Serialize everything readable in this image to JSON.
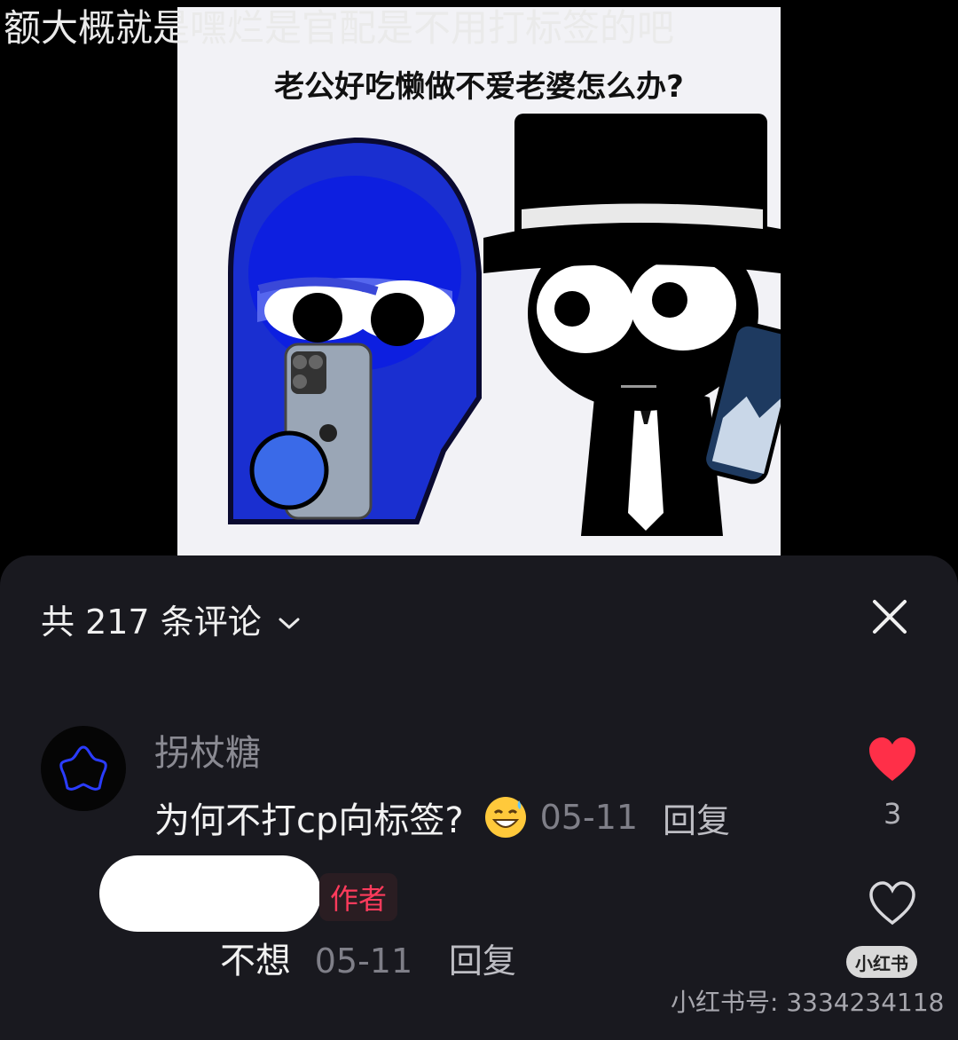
{
  "caption": "额大概就是嘿烂是官配是不用打标签的吧",
  "meme": {
    "title": "老公好吃懒做不爱老婆怎么办?"
  },
  "comments_sheet": {
    "header": "共 217 条评论",
    "comments": [
      {
        "username": "拐杖糖",
        "text": "为何不打cp向标签?",
        "emoji": "sweat-smile-emoji",
        "date": "05-11",
        "reply_label": "回复",
        "like_count": "3",
        "liked": true
      }
    ],
    "reply": {
      "author_badge": "作者",
      "text": "不想",
      "date": "05-11",
      "reply_label": "回复"
    }
  },
  "watermark": {
    "logo": "小红书",
    "id_text": "小红书号: 3334234118"
  },
  "colors": {
    "sheet_bg": "#19191f",
    "like_red": "#ff2f48",
    "author_badge": "#ff3b5c"
  }
}
